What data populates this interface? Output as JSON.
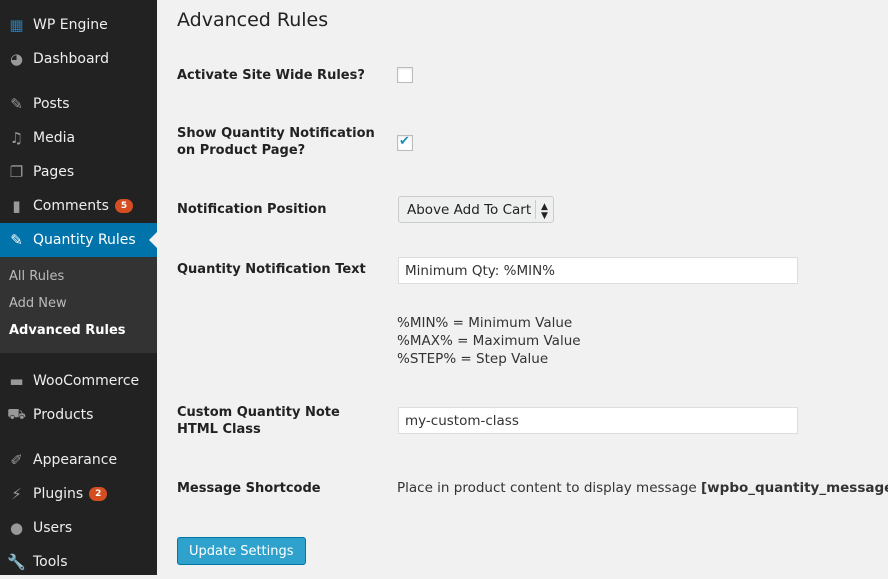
{
  "sidebar": {
    "items": [
      {
        "label": "WP Engine",
        "icon": "grid-icon"
      },
      {
        "label": "Dashboard",
        "icon": "dashboard-icon"
      },
      {
        "label": "Posts",
        "icon": "pin-icon"
      },
      {
        "label": "Media",
        "icon": "media-icon"
      },
      {
        "label": "Pages",
        "icon": "pages-icon"
      },
      {
        "label": "Comments",
        "icon": "comment-icon",
        "badge": "5"
      },
      {
        "label": "Quantity Rules",
        "icon": "pin-icon"
      },
      {
        "label": "WooCommerce",
        "icon": "woo-icon"
      },
      {
        "label": "Products",
        "icon": "cart-icon"
      },
      {
        "label": "Appearance",
        "icon": "brush-icon"
      },
      {
        "label": "Plugins",
        "icon": "plug-icon",
        "badge": "2"
      },
      {
        "label": "Users",
        "icon": "user-icon"
      },
      {
        "label": "Tools",
        "icon": "wrench-icon"
      }
    ],
    "submenu": [
      "All Rules",
      "Add New",
      "Advanced Rules"
    ]
  },
  "page": {
    "title": "Advanced Rules",
    "activate_label": "Activate Site Wide Rules?",
    "activate_checked": false,
    "show_label": "Show Quantity Notification on Product Page?",
    "show_checked": true,
    "position_label": "Notification Position",
    "position_value": "Above Add To Cart",
    "text_label": "Quantity Notification Text",
    "text_value": "Minimum Qty: %MIN%",
    "help": [
      "%MIN% = Minimum Value",
      "%MAX% = Maximum Value",
      "%STEP% = Step Value"
    ],
    "class_label": "Custom Quantity Note HTML Class",
    "class_value": "my-custom-class",
    "shortcode_label": "Message Shortcode",
    "shortcode_text": "Place in product content to display message ",
    "shortcode": "[wpbo_quantity_message]",
    "update_button": "Update Settings"
  },
  "colors": {
    "accent": "#0073aa",
    "button": "#2ea2cc",
    "badge": "#d54e21"
  }
}
